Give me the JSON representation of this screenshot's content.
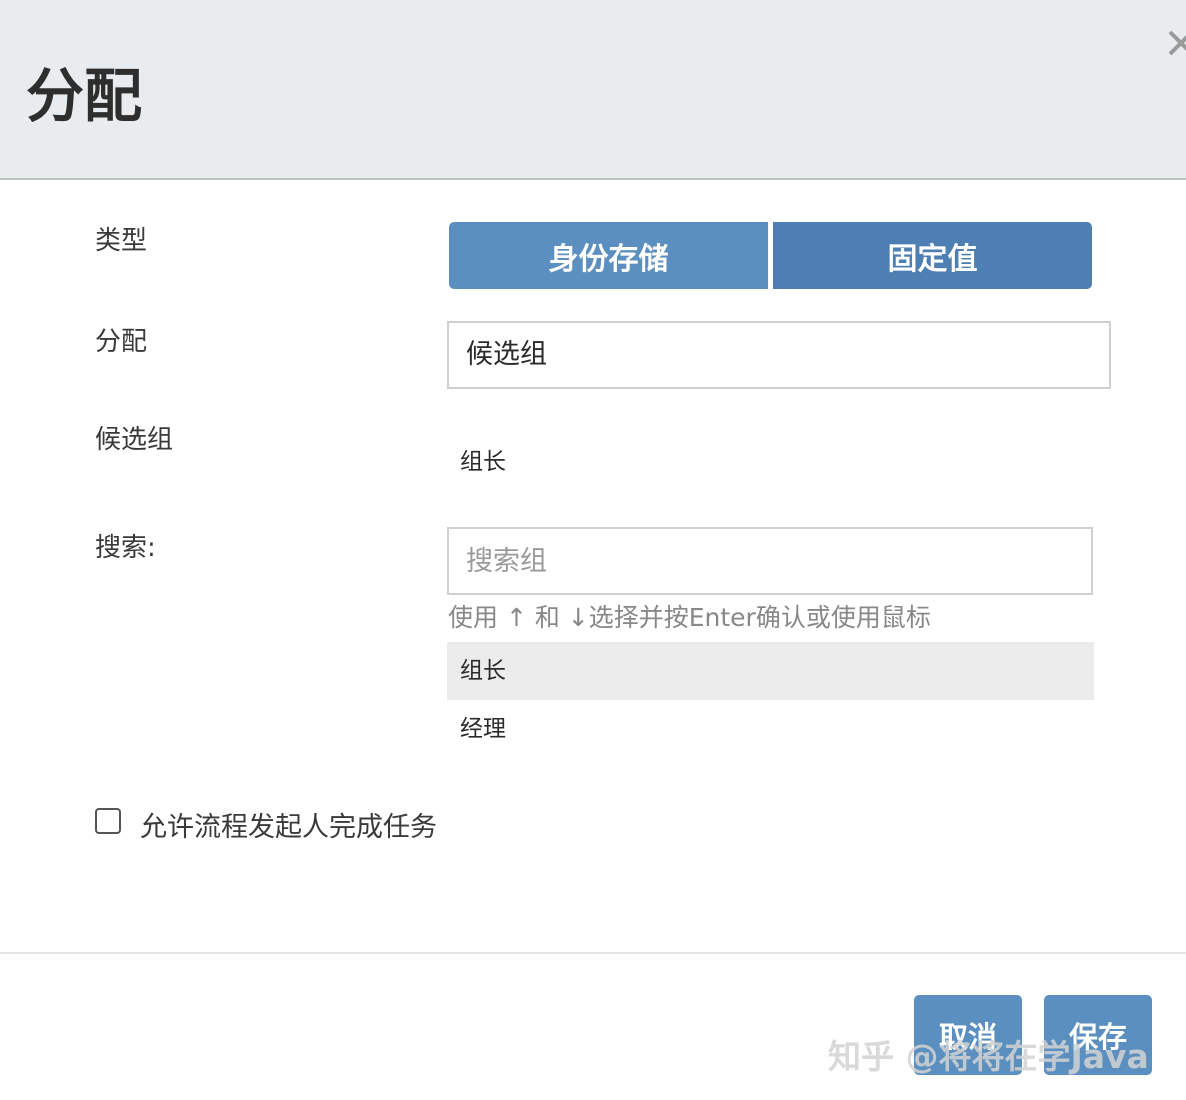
{
  "dialog": {
    "title": "分配",
    "close_icon": "close-icon"
  },
  "form": {
    "type_label": "类型",
    "type_options": [
      "身份存储",
      "固定值"
    ],
    "assign_label": "分配",
    "assign_value": "候选组",
    "candidate_label": "候选组",
    "candidate_value": "组长",
    "search_label": "搜索:",
    "search_placeholder": "搜索组",
    "hint": "使用 ↑ 和 ↓选择并按Enter确认或使用鼠标",
    "results": [
      "组长",
      "经理"
    ],
    "allow_initiator_label": "允许流程发起人完成任务"
  },
  "footer": {
    "cancel_label": "取消",
    "save_label": "保存"
  },
  "watermark": "知乎 @将将在学Java",
  "colors": {
    "primary_button": "#5b8fbf",
    "primary_button_dark": "#4e7fb2",
    "header_bg": "#e9ecef"
  }
}
